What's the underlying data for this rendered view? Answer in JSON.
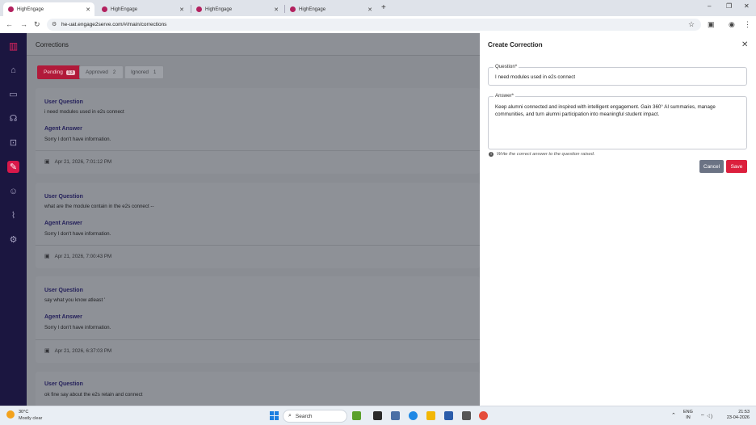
{
  "browser": {
    "tabs": [
      {
        "title": "HighEngage",
        "active": true
      },
      {
        "title": "HighEngage",
        "active": false
      },
      {
        "title": "HighEngage",
        "active": false
      },
      {
        "title": "HighEngage",
        "active": false
      }
    ],
    "url": "he-uat.engage2serve.com/#/main/corrections",
    "new_tab": "+",
    "controls": {
      "minimize": "–",
      "maximize": "❐",
      "close": "✕"
    }
  },
  "sidebar": {
    "items": [
      {
        "icon": "logo-icon"
      },
      {
        "icon": "home-icon"
      },
      {
        "icon": "chat-icon"
      },
      {
        "icon": "headset-icon"
      },
      {
        "icon": "lock-icon"
      },
      {
        "icon": "corrections-icon",
        "active": true
      },
      {
        "icon": "users-icon"
      },
      {
        "icon": "analytics-icon"
      },
      {
        "icon": "settings-icon"
      }
    ]
  },
  "main": {
    "title": "Corrections",
    "filters": [
      {
        "label": "Pending",
        "count": "13",
        "active": true
      },
      {
        "label": "Approved",
        "count": "2",
        "active": false
      },
      {
        "label": "Ignored",
        "count": "1",
        "active": false
      }
    ],
    "question_label": "User Question",
    "answer_label": "Agent Answer",
    "cards": [
      {
        "question": "i need modules used in e2s connect",
        "answer": "Sorry I don't have information.",
        "date": "Apr 21, 2026, 7:01:12 PM"
      },
      {
        "question": "what are the module contain in the e2s connect --",
        "answer": "Sorry I don't have information.",
        "date": "Apr 21, 2026, 7:00:43 PM"
      },
      {
        "question": "say what you know atleast '",
        "answer": "Sorry I don't have information.",
        "date": "Apr 21, 2026, 6:37:03 PM"
      },
      {
        "question": "ok fine say about the e2s retain and connect",
        "answer": "",
        "date": ""
      }
    ]
  },
  "drawer": {
    "title": "Create Correction",
    "question_label": "Question*",
    "question_value": "I need modules used in e2s connect",
    "answer_label": "Answer*",
    "answer_value": "Keep alumni connected and inspired with intelligent engagement. Gain 360° AI summaries, manage communities, and turn alumni participation into meaningful student impact.",
    "hint": "Write the correct answer to the question raised.",
    "cancel_label": "Cancel",
    "save_label": "Save"
  },
  "taskbar": {
    "temperature": "30°C",
    "weather": "Mostly clear",
    "search_placeholder": "Search",
    "lang_top": "ENG",
    "lang_bottom": "IN",
    "time": "21:53",
    "date": "23-04-2026"
  },
  "colors": {
    "sidebar_bg": "#1b1640",
    "accent": "#d8184a",
    "label_color": "#231f5a",
    "cancel_bg": "#6b7384"
  }
}
